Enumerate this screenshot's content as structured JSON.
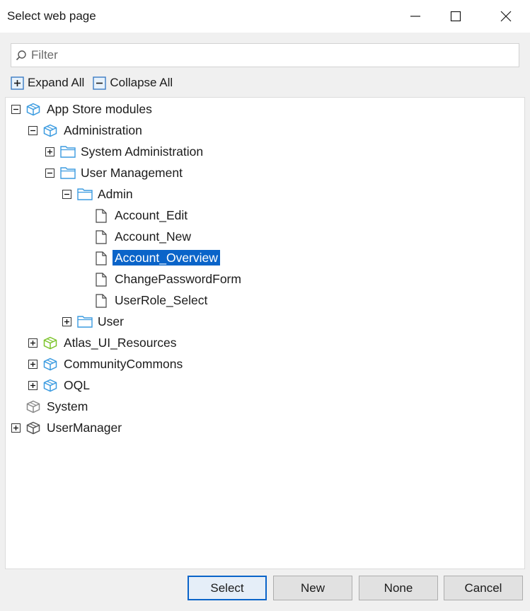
{
  "window": {
    "title": "Select web page",
    "controls": {
      "minimize": "minimize-icon",
      "maximize": "maximize-icon",
      "close": "close-icon"
    }
  },
  "filter": {
    "placeholder": "Filter",
    "value": ""
  },
  "toolbar": {
    "expand_all": "Expand All",
    "collapse_all": "Collapse All"
  },
  "tree": [
    {
      "label": "App Store modules",
      "icon": "module-icon",
      "icon_color": "#3b9be0",
      "expander": "collapse",
      "selected": false
    },
    {
      "label": "Administration",
      "icon": "module-icon",
      "icon_color": "#3b9be0",
      "expander": "collapse",
      "selected": false
    },
    {
      "label": "System Administration",
      "icon": "folder-icon",
      "icon_color": "#3b9be0",
      "expander": "expand",
      "selected": false
    },
    {
      "label": "User Management",
      "icon": "folder-icon",
      "icon_color": "#3b9be0",
      "expander": "collapse",
      "selected": false
    },
    {
      "label": "Admin",
      "icon": "folder-icon",
      "icon_color": "#3b9be0",
      "expander": "collapse",
      "selected": false
    },
    {
      "label": "Account_Edit",
      "icon": "page-icon",
      "icon_color": "#444444",
      "expander": "none",
      "selected": false
    },
    {
      "label": "Account_New",
      "icon": "page-icon",
      "icon_color": "#444444",
      "expander": "none",
      "selected": false
    },
    {
      "label": "Account_Overview",
      "icon": "page-icon",
      "icon_color": "#444444",
      "expander": "none",
      "selected": true
    },
    {
      "label": "ChangePasswordForm",
      "icon": "page-icon",
      "icon_color": "#444444",
      "expander": "none",
      "selected": false
    },
    {
      "label": "UserRole_Select",
      "icon": "page-icon",
      "icon_color": "#444444",
      "expander": "none",
      "selected": false
    },
    {
      "label": "User",
      "icon": "folder-icon",
      "icon_color": "#3b9be0",
      "expander": "expand",
      "selected": false
    },
    {
      "label": "Atlas_UI_Resources",
      "icon": "module-icon",
      "icon_color": "#7cc42b",
      "expander": "expand",
      "selected": false
    },
    {
      "label": "CommunityCommons",
      "icon": "module-icon",
      "icon_color": "#3b9be0",
      "expander": "expand",
      "selected": false
    },
    {
      "label": "OQL",
      "icon": "module-icon",
      "icon_color": "#3b9be0",
      "expander": "expand",
      "selected": false
    },
    {
      "label": "System",
      "icon": "module-icon",
      "icon_color": "#8a8a8a",
      "expander": "none",
      "selected": false
    },
    {
      "label": "UserManager",
      "icon": "module-icon",
      "icon_color": "#555555",
      "expander": "expand",
      "selected": false
    }
  ],
  "buttons": {
    "select": "Select",
    "new": "New",
    "none": "None",
    "cancel": "Cancel"
  },
  "colors": {
    "selection": "#0a64c9",
    "accent": "#3b9be0"
  }
}
